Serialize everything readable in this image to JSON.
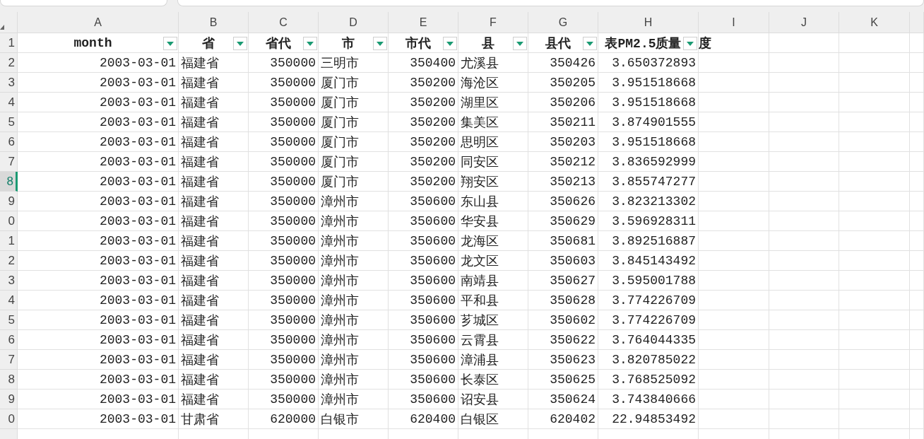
{
  "columns": [
    {
      "letter": "A",
      "header": "month",
      "kind": "number",
      "filter": true
    },
    {
      "letter": "B",
      "header": "省",
      "kind": "text",
      "filter": true
    },
    {
      "letter": "C",
      "header": "省代",
      "kind": "number",
      "filter": true
    },
    {
      "letter": "D",
      "header": "市",
      "kind": "text",
      "filter": true
    },
    {
      "letter": "E",
      "header": "市代",
      "kind": "number",
      "filter": true
    },
    {
      "letter": "F",
      "header": "县",
      "kind": "text",
      "filter": true
    },
    {
      "letter": "G",
      "header": "县代",
      "kind": "number",
      "filter": true
    },
    {
      "letter": "H",
      "header": "表PM2.5质量",
      "kind": "number",
      "filter": true
    },
    {
      "letter": "I",
      "header_spill": "度",
      "kind": "text",
      "filter": false
    },
    {
      "letter": "J",
      "kind": "text",
      "filter": false
    },
    {
      "letter": "K",
      "kind": "text",
      "filter": false
    }
  ],
  "header_row_number": "1",
  "rows": [
    {
      "number": "2",
      "selected": false,
      "cells": [
        "2003-03-01",
        "福建省",
        "350000",
        "三明市",
        "350400",
        "尤溪县",
        "350426",
        "3.650372893"
      ]
    },
    {
      "number": "3",
      "selected": false,
      "cells": [
        "2003-03-01",
        "福建省",
        "350000",
        "厦门市",
        "350200",
        "海沧区",
        "350205",
        "3.951518668"
      ]
    },
    {
      "number": "4",
      "selected": false,
      "cells": [
        "2003-03-01",
        "福建省",
        "350000",
        "厦门市",
        "350200",
        "湖里区",
        "350206",
        "3.951518668"
      ]
    },
    {
      "number": "5",
      "selected": false,
      "cells": [
        "2003-03-01",
        "福建省",
        "350000",
        "厦门市",
        "350200",
        "集美区",
        "350211",
        "3.874901555"
      ]
    },
    {
      "number": "6",
      "selected": false,
      "cells": [
        "2003-03-01",
        "福建省",
        "350000",
        "厦门市",
        "350200",
        "思明区",
        "350203",
        "3.951518668"
      ]
    },
    {
      "number": "7",
      "selected": false,
      "cells": [
        "2003-03-01",
        "福建省",
        "350000",
        "厦门市",
        "350200",
        "同安区",
        "350212",
        "3.836592999"
      ]
    },
    {
      "number": "8",
      "selected": true,
      "cells": [
        "2003-03-01",
        "福建省",
        "350000",
        "厦门市",
        "350200",
        "翔安区",
        "350213",
        "3.855747277"
      ]
    },
    {
      "number": "9",
      "selected": false,
      "cells": [
        "2003-03-01",
        "福建省",
        "350000",
        "漳州市",
        "350600",
        "东山县",
        "350626",
        "3.823213302"
      ]
    },
    {
      "number": "0",
      "selected": false,
      "cells": [
        "2003-03-01",
        "福建省",
        "350000",
        "漳州市",
        "350600",
        "华安县",
        "350629",
        "3.596928311"
      ]
    },
    {
      "number": "1",
      "selected": false,
      "cells": [
        "2003-03-01",
        "福建省",
        "350000",
        "漳州市",
        "350600",
        "龙海区",
        "350681",
        "3.892516887"
      ]
    },
    {
      "number": "2",
      "selected": false,
      "cells": [
        "2003-03-01",
        "福建省",
        "350000",
        "漳州市",
        "350600",
        "龙文区",
        "350603",
        "3.845143492"
      ]
    },
    {
      "number": "3",
      "selected": false,
      "cells": [
        "2003-03-01",
        "福建省",
        "350000",
        "漳州市",
        "350600",
        "南靖县",
        "350627",
        "3.595001788"
      ]
    },
    {
      "number": "4",
      "selected": false,
      "cells": [
        "2003-03-01",
        "福建省",
        "350000",
        "漳州市",
        "350600",
        "平和县",
        "350628",
        "3.774226709"
      ]
    },
    {
      "number": "5",
      "selected": false,
      "cells": [
        "2003-03-01",
        "福建省",
        "350000",
        "漳州市",
        "350600",
        "芗城区",
        "350602",
        "3.774226709"
      ]
    },
    {
      "number": "6",
      "selected": false,
      "cells": [
        "2003-03-01",
        "福建省",
        "350000",
        "漳州市",
        "350600",
        "云霄县",
        "350622",
        "3.764044335"
      ]
    },
    {
      "number": "7",
      "selected": false,
      "cells": [
        "2003-03-01",
        "福建省",
        "350000",
        "漳州市",
        "350600",
        "漳浦县",
        "350623",
        "3.820785022"
      ]
    },
    {
      "number": "8",
      "selected": false,
      "cells": [
        "2003-03-01",
        "福建省",
        "350000",
        "漳州市",
        "350600",
        "长泰区",
        "350625",
        "3.768525092"
      ]
    },
    {
      "number": "9",
      "selected": false,
      "cells": [
        "2003-03-01",
        "福建省",
        "350000",
        "漳州市",
        "350600",
        "诏安县",
        "350624",
        "3.743840666"
      ]
    },
    {
      "number": "0",
      "selected": false,
      "cells": [
        "2003-03-01",
        "甘肃省",
        "620000",
        "白银市",
        "620400",
        "白银区",
        "620402",
        "22.94853492"
      ]
    }
  ]
}
